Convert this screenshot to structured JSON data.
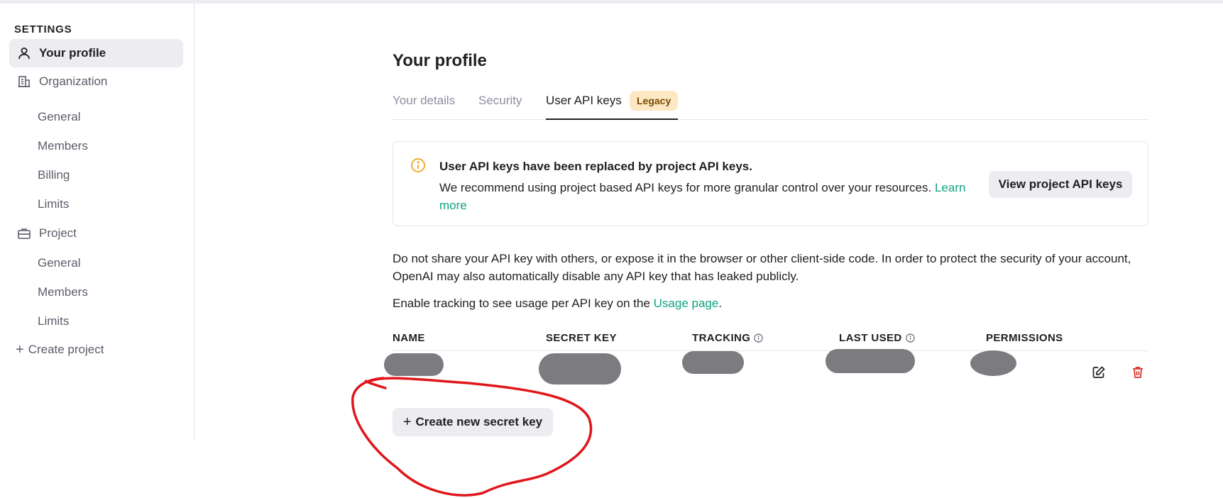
{
  "sidebar": {
    "heading": "SETTINGS",
    "your_profile": "Your profile",
    "organization": "Organization",
    "org_items": [
      "General",
      "Members",
      "Billing",
      "Limits"
    ],
    "project": "Project",
    "project_items": [
      "General",
      "Members",
      "Limits"
    ],
    "create_project": "Create project"
  },
  "main": {
    "title": "Your profile",
    "tabs": [
      "Your details",
      "Security",
      "User API keys"
    ],
    "legacy_badge": "Legacy",
    "notice": {
      "title": "User API keys have been replaced by project API keys.",
      "body": "We recommend using project based API keys for more granular control over your resources.",
      "link": "Learn more",
      "button": "View project API keys"
    },
    "warning_text": "Do not share your API key with others, or expose it in the browser or other client-side code. In order to protect the security of your account, OpenAI may also automatically disable any API key that has leaked publicly.",
    "tracking_text": "Enable tracking to see usage per API key on the",
    "usage_link": "Usage page",
    "tracking_period": ".",
    "table": {
      "headers": [
        "NAME",
        "SECRET KEY",
        "TRACKING",
        "LAST USED",
        "PERMISSIONS"
      ]
    },
    "create_key_button": "Create new secret key"
  },
  "colors": {
    "accent_link": "#10a37f",
    "legacy_badge_bg": "#fde8c4",
    "delete_red": "#d93025",
    "annotation_red": "#e0161b",
    "info_orange": "#f0a41c"
  },
  "icons": [
    "person-icon",
    "building-icon",
    "briefcase-icon",
    "plus-icon",
    "info-circle-icon",
    "edit-icon",
    "trash-icon"
  ]
}
